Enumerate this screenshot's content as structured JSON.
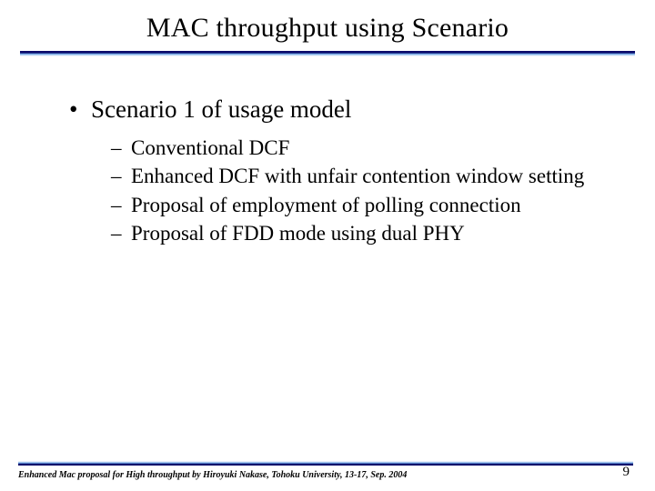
{
  "title": "MAC throughput using Scenario",
  "bullets": {
    "l1": {
      "marker": "•",
      "text": "Scenario 1 of usage model"
    },
    "l2": [
      {
        "marker": "–",
        "text": "Conventional DCF"
      },
      {
        "marker": "–",
        "text": "Enhanced DCF with unfair contention window setting"
      },
      {
        "marker": "–",
        "text": "Proposal of employment of polling connection"
      },
      {
        "marker": "–",
        "text": "Proposal of FDD mode using dual PHY"
      }
    ]
  },
  "footer": {
    "text": "Enhanced Mac proposal for High throughput by Hiroyuki Nakase, Tohoku University, 13-17, Sep. 2004",
    "page": "9"
  }
}
